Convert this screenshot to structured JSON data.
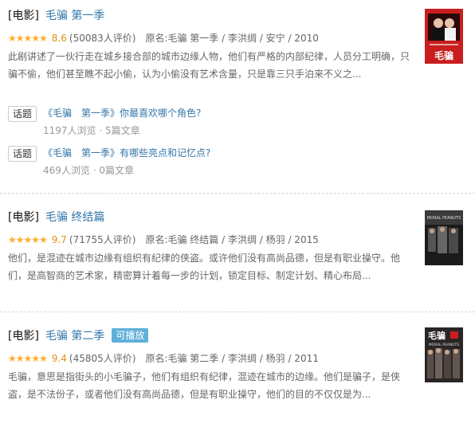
{
  "results": [
    {
      "category": "[电影]",
      "title": "毛骗 第一季",
      "stars": "★★★★★",
      "score": "8.6",
      "votes": "(50083人评价)",
      "subject": "原名:毛骗 第一季 / 李洪绸 / 安宁 / 2010",
      "desc": "此剧讲述了一伙行走在城乡接合部的城市边缘人物，他们有严格的内部纪律，人员分工明确，只骗不偷，他们甚至瞧不起小偷，认为小偷没有艺术含量，只是靠三只手泊来不义之...",
      "poster_text": "毛骗",
      "topics": [
        {
          "badge": "话题",
          "title": "《毛骗　第一季》你最喜欢哪个角色?",
          "meta": "1197人浏览 · 5篇文章"
        },
        {
          "badge": "话题",
          "title": "《毛骗　第一季》有哪些亮点和记忆点?",
          "meta": "469人浏览 · 0篇文章"
        }
      ]
    },
    {
      "category": "[电影]",
      "title": "毛骗 终结篇",
      "stars": "★★★★★",
      "score": "9.7",
      "votes": "(71755人评价)",
      "subject": "原名:毛骗 终结篇 / 李洪绸 / 杨羽 / 2015",
      "desc": "他们，是混迹在城市边缘有组织有纪律的侠盗。或许他们没有高尚品德，但是有职业操守。他们，是高智商的艺术家，精密算计着每一步的计划，锁定目标、制定计划、精心布局...",
      "poster_text": "MORAL PEANUTS"
    },
    {
      "category": "[电影]",
      "title": "毛骗 第二季",
      "badge": "可播放",
      "stars": "★★★★★",
      "score": "9.4",
      "votes": "(45805人评价)",
      "subject": "原名:毛骗 第二季 / 李洪绸 / 杨羽 / 2011",
      "desc": "毛骗，意思是指街头的小毛骗子，他们有组织有纪律，混迹在城市的边缘。他们是骗子，是侠盗，是不法份子，或者他们没有高尚品德，但是有职业操守，他们的目的不仅仅是为...",
      "poster_text": "毛骗",
      "poster_sub": "MORAL PEANUTS"
    }
  ]
}
